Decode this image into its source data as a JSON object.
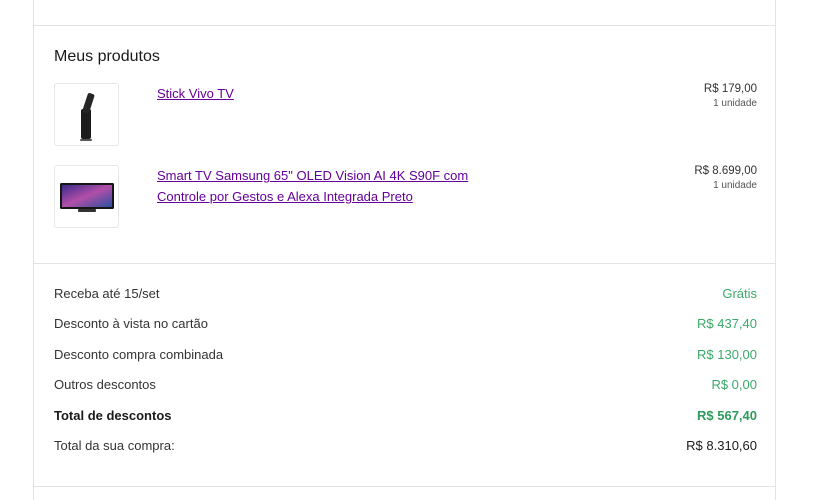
{
  "section_title": "Meus produtos",
  "products": [
    {
      "name": "Stick Vivo TV",
      "price": "R$ 179,00",
      "qty": "1 unidade"
    },
    {
      "name": "Smart TV Samsung 65\" OLED Vision AI 4K S90F com Controle por Gestos e Alexa Integrada Preto",
      "price": "R$ 8.699,00",
      "qty": "1 unidade"
    }
  ],
  "summary": [
    {
      "label": "Receba até 15/set",
      "value": "Grátis"
    },
    {
      "label": "Desconto à vista no cartão",
      "value": "R$ 437,40"
    },
    {
      "label": "Desconto compra combinada",
      "value": "R$ 130,00"
    },
    {
      "label": "Outros descontos",
      "value": "R$ 0,00"
    },
    {
      "label": "Total de descontos",
      "value": "R$ 567,40"
    },
    {
      "label": "Total da sua compra:",
      "value": "R$ 8.310,60"
    }
  ],
  "colors": {
    "link": "#660099",
    "discount_green": "#3aaa6a",
    "border": "#e3e3e3"
  }
}
